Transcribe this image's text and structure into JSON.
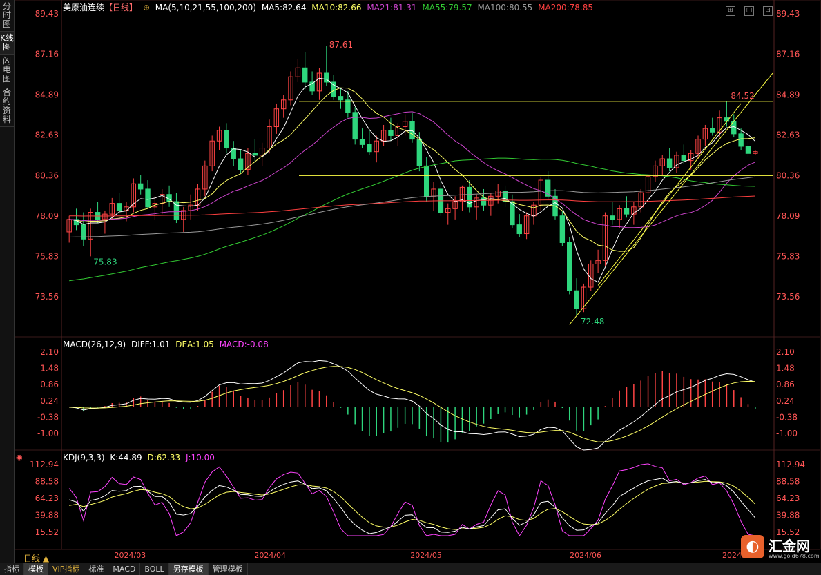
{
  "side_tabs": [
    "分时图",
    "K线图",
    "闪电图",
    "合约资料"
  ],
  "main_legend": {
    "title": "美原油连续",
    "period": "【日线】",
    "ma_params": "MA(5,10,21,55,100,200)",
    "ma5": "MA5:82.64",
    "ma10": "MA10:82.66",
    "ma21": "MA21:81.31",
    "ma55": "MA55:79.57",
    "ma100": "MA100:80.55",
    "ma200": "MA200:78.85"
  },
  "macd_legend": {
    "params": "MACD(26,12,9)",
    "diff": "DIFF:1.01",
    "dea": "DEA:1.05",
    "macd": "MACD:-0.08"
  },
  "kdj_legend": {
    "params": "KDJ(9,3,3)",
    "k": "K:44.89",
    "d": "D:62.33",
    "j": "J:10.00"
  },
  "price_ticks": [
    "89.43",
    "87.16",
    "84.89",
    "82.63",
    "80.36",
    "78.09",
    "75.83",
    "73.56"
  ],
  "macd_ticks": [
    "2.10",
    "1.48",
    "0.86",
    "0.24",
    "-0.38",
    "-1.00"
  ],
  "kdj_ticks": [
    "112.94",
    "88.58",
    "64.23",
    "39.88",
    "15.52"
  ],
  "date_labels": [
    "2024/03",
    "2024/04",
    "2024/05",
    "2024/06",
    "2024/07"
  ],
  "annotations": {
    "high": "87.61",
    "low_left": "75.83",
    "low": "72.48",
    "right_high": "84.52"
  },
  "period_label": "日线",
  "bottom_tabs": [
    "指标",
    "模板",
    "VIP指标",
    "标准",
    "MACD",
    "BOLL",
    "另存模板",
    "管理模板"
  ],
  "brand": {
    "name": "汇金网",
    "url": "www.gold678.com"
  },
  "colors": {
    "up": "#ff4444",
    "down": "#2ed67d",
    "ma5": "#ffffff",
    "ma10": "#ffff66",
    "ma21": "#cc44cc",
    "ma55": "#33cc33",
    "ma100": "#999999",
    "ma200": "#ff4040",
    "axis_text": "#ff5555",
    "trend": "#ffff44"
  },
  "chart_data": {
    "type": "candlestick",
    "instrument": "美原油连续",
    "period": "日线",
    "x_range": [
      "2024/02",
      "2024/07"
    ],
    "ylim": [
      72.48,
      89.43
    ],
    "candles": [
      [
        77.2,
        78.1,
        76.6,
        77.9
      ],
      [
        77.9,
        78.5,
        77.3,
        77.6
      ],
      [
        77.6,
        78.3,
        76.4,
        76.8
      ],
      [
        76.8,
        78.5,
        75.83,
        78.3
      ],
      [
        78.3,
        78.9,
        77.7,
        77.9
      ],
      [
        77.9,
        78.4,
        77.1,
        78.2
      ],
      [
        78.2,
        79.1,
        77.9,
        78.8
      ],
      [
        78.8,
        79.4,
        78.3,
        78.4
      ],
      [
        78.4,
        78.9,
        77.8,
        78.6
      ],
      [
        78.6,
        80.2,
        78.3,
        79.9
      ],
      [
        79.9,
        80.4,
        79.3,
        79.6
      ],
      [
        79.6,
        80.1,
        78.5,
        78.6
      ],
      [
        78.6,
        79.2,
        77.9,
        78.8
      ],
      [
        78.8,
        79.6,
        78.2,
        79.3
      ],
      [
        79.3,
        79.8,
        78.6,
        78.9
      ],
      [
        78.9,
        79.4,
        77.7,
        77.9
      ],
      [
        77.9,
        78.6,
        77.2,
        78.4
      ],
      [
        78.4,
        79.3,
        77.9,
        78.7
      ],
      [
        78.7,
        79.9,
        78.4,
        79.6
      ],
      [
        79.6,
        81.2,
        79.2,
        80.9
      ],
      [
        80.9,
        82.6,
        80.6,
        82.3
      ],
      [
        82.3,
        83.1,
        81.8,
        82.9
      ],
      [
        82.9,
        83.3,
        81.6,
        81.9
      ],
      [
        81.9,
        82.3,
        80.9,
        81.3
      ],
      [
        81.3,
        81.8,
        80.5,
        80.7
      ],
      [
        80.7,
        81.9,
        80.4,
        81.6
      ],
      [
        81.6,
        82.4,
        81.1,
        81.5
      ],
      [
        81.5,
        82.2,
        80.9,
        81.9
      ],
      [
        81.9,
        83.5,
        81.6,
        83.1
      ],
      [
        83.1,
        84.4,
        82.7,
        84.1
      ],
      [
        84.1,
        84.9,
        83.6,
        84.6
      ],
      [
        84.6,
        86.2,
        84.3,
        85.9
      ],
      [
        85.9,
        86.9,
        85.6,
        86.4
      ],
      [
        86.4,
        87.3,
        85.2,
        85.6
      ],
      [
        85.6,
        86.2,
        84.9,
        85.1
      ],
      [
        85.1,
        86.4,
        84.6,
        86.1
      ],
      [
        86.1,
        87.61,
        85.4,
        85.6
      ],
      [
        85.6,
        86.0,
        84.6,
        84.8
      ],
      [
        84.8,
        85.3,
        84.1,
        84.6
      ],
      [
        84.6,
        85.1,
        83.6,
        83.9
      ],
      [
        83.9,
        84.2,
        82.1,
        82.4
      ],
      [
        82.4,
        83.0,
        81.9,
        82.1
      ],
      [
        82.1,
        82.9,
        81.5,
        81.7
      ],
      [
        81.7,
        82.6,
        81.1,
        82.3
      ],
      [
        82.3,
        83.2,
        82.0,
        82.9
      ],
      [
        82.9,
        83.6,
        82.3,
        82.6
      ],
      [
        82.6,
        83.3,
        82.0,
        83.1
      ],
      [
        83.1,
        83.8,
        82.6,
        83.4
      ],
      [
        83.4,
        83.9,
        82.2,
        82.4
      ],
      [
        82.4,
        82.8,
        80.6,
        80.9
      ],
      [
        80.9,
        81.4,
        78.9,
        79.2
      ],
      [
        79.2,
        80.0,
        78.4,
        79.6
      ],
      [
        79.6,
        80.3,
        78.1,
        78.3
      ],
      [
        78.3,
        78.8,
        77.6,
        78.5
      ],
      [
        78.5,
        79.2,
        77.9,
        78.9
      ],
      [
        78.9,
        79.8,
        78.4,
        79.7
      ],
      [
        79.7,
        80.1,
        78.3,
        78.6
      ],
      [
        78.6,
        79.3,
        77.9,
        79.1
      ],
      [
        79.1,
        79.6,
        78.4,
        78.7
      ],
      [
        78.7,
        79.4,
        78.1,
        79.2
      ],
      [
        79.2,
        79.9,
        78.8,
        79.5
      ],
      [
        79.5,
        79.8,
        78.6,
        78.9
      ],
      [
        78.9,
        79.3,
        77.4,
        77.6
      ],
      [
        77.6,
        78.2,
        76.9,
        77.1
      ],
      [
        77.1,
        78.3,
        76.8,
        78.1
      ],
      [
        78.1,
        78.9,
        77.6,
        78.7
      ],
      [
        78.7,
        80.3,
        78.4,
        80.1
      ],
      [
        80.1,
        80.6,
        79.0,
        79.2
      ],
      [
        79.2,
        79.6,
        77.9,
        78.1
      ],
      [
        78.1,
        78.4,
        76.4,
        76.6
      ],
      [
        76.6,
        76.9,
        73.7,
        73.9
      ],
      [
        73.9,
        74.6,
        72.48,
        72.9
      ],
      [
        72.9,
        74.3,
        72.7,
        74.1
      ],
      [
        74.1,
        75.6,
        73.9,
        75.4
      ],
      [
        75.4,
        76.2,
        74.9,
        75.6
      ],
      [
        75.6,
        78.3,
        75.3,
        78.1
      ],
      [
        78.1,
        78.9,
        77.6,
        77.9
      ],
      [
        77.9,
        78.7,
        77.4,
        78.5
      ],
      [
        78.5,
        79.2,
        78.0,
        78.2
      ],
      [
        78.2,
        78.9,
        77.6,
        78.6
      ],
      [
        78.6,
        79.6,
        78.3,
        79.4
      ],
      [
        79.4,
        80.4,
        79.1,
        80.3
      ],
      [
        80.3,
        81.2,
        80.0,
        80.9
      ],
      [
        80.9,
        81.5,
        80.4,
        81.3
      ],
      [
        81.3,
        81.9,
        80.6,
        80.8
      ],
      [
        80.8,
        81.7,
        80.5,
        81.5
      ],
      [
        81.5,
        82.1,
        81.0,
        81.2
      ],
      [
        81.2,
        81.8,
        80.7,
        81.6
      ],
      [
        81.6,
        82.6,
        81.3,
        82.4
      ],
      [
        82.4,
        83.2,
        82.0,
        83.0
      ],
      [
        83.0,
        83.6,
        82.6,
        82.8
      ],
      [
        82.8,
        84.0,
        82.5,
        83.6
      ],
      [
        83.6,
        84.52,
        83.1,
        83.4
      ],
      [
        83.4,
        83.8,
        82.5,
        82.7
      ],
      [
        82.7,
        83.0,
        81.8,
        82.0
      ],
      [
        82.0,
        82.3,
        81.4,
        81.6
      ],
      [
        81.6,
        81.8,
        81.5,
        81.7
      ]
    ],
    "hlines": [
      84.52,
      80.36
    ]
  }
}
